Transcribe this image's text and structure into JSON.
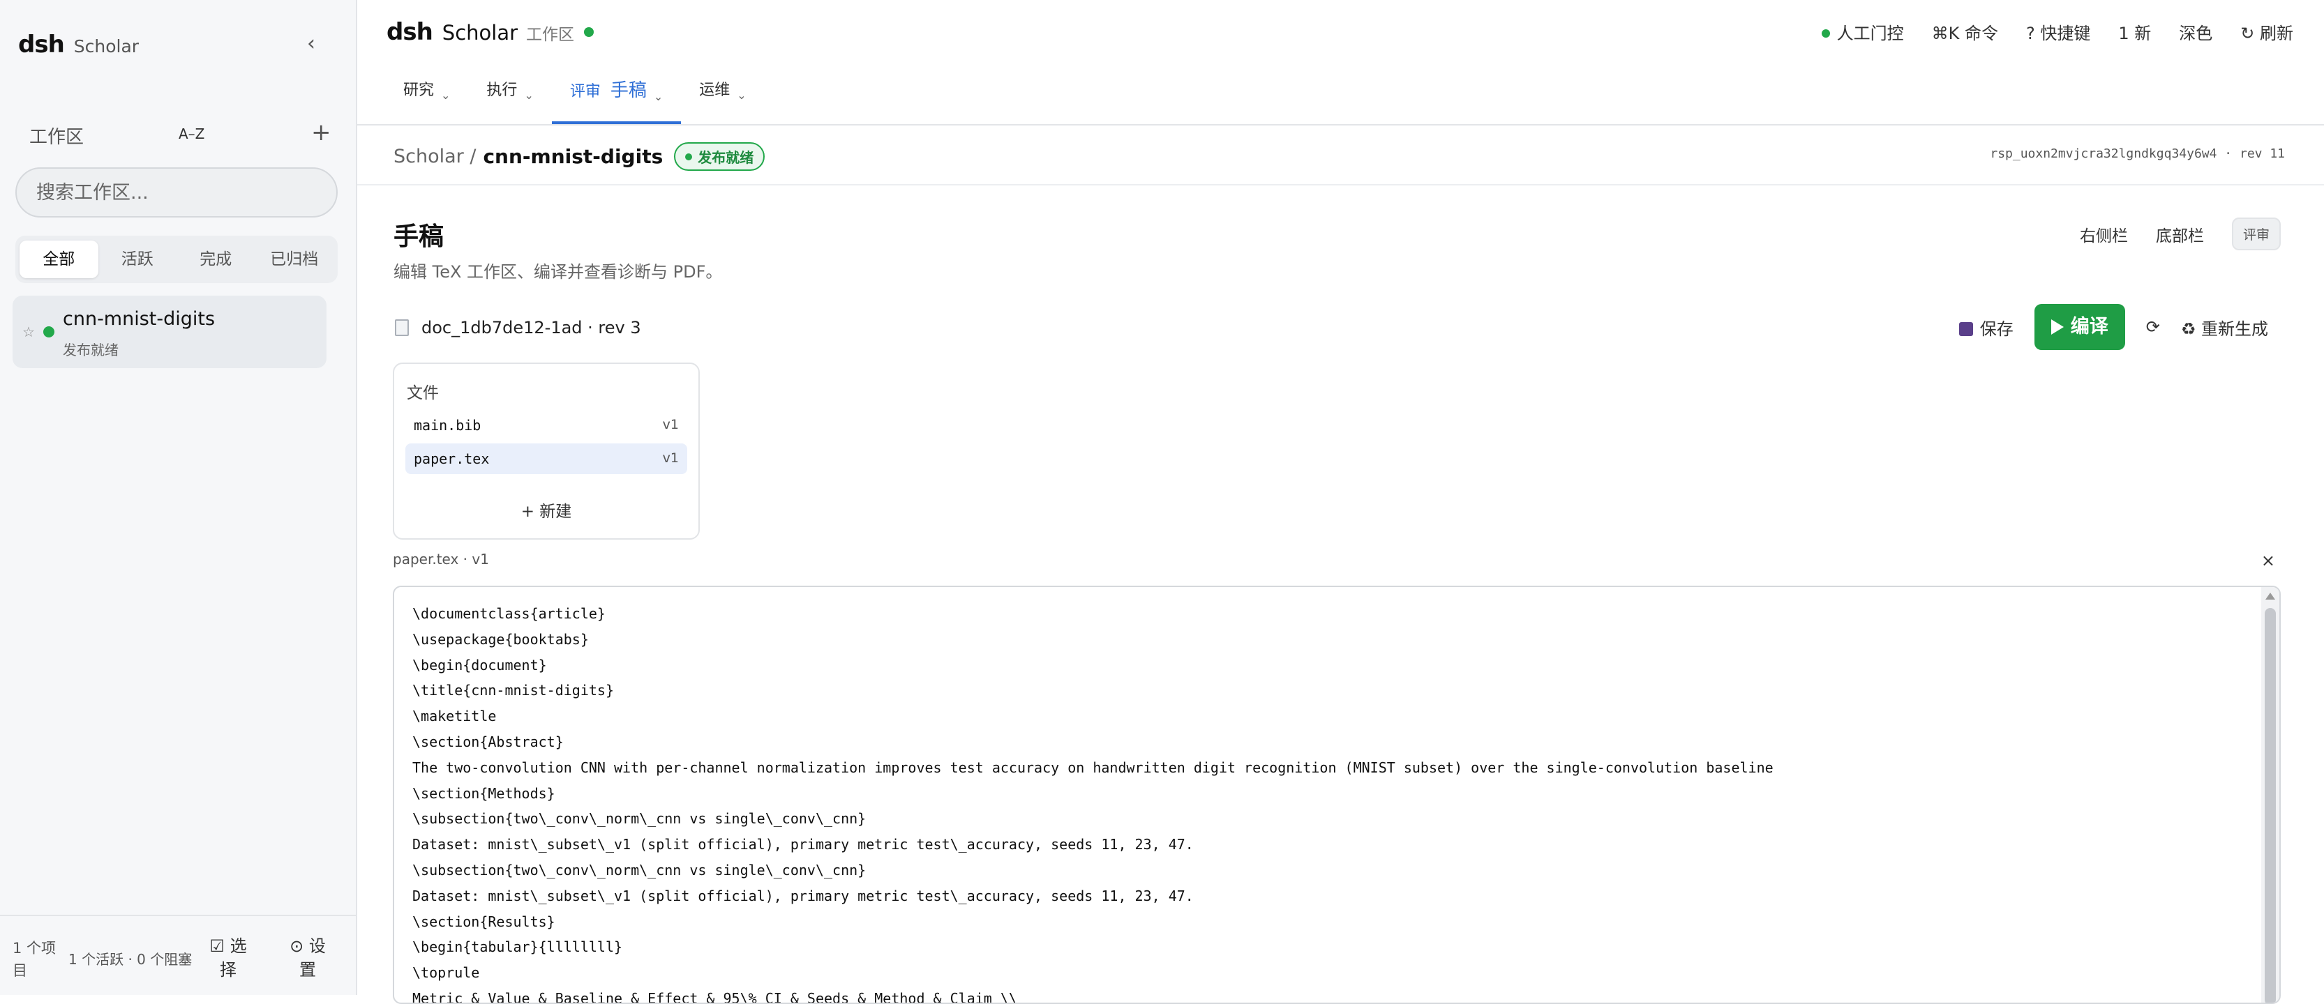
{
  "sidebar": {
    "brand_logo": "dsh",
    "brand_name": "Scholar",
    "collapse": "‹",
    "workspace_label": "工作区",
    "sort_label": "A–Z",
    "add_label": "+",
    "search_placeholder": "搜索工作区...",
    "filters": [
      "全部",
      "活跃",
      "完成",
      "已归档"
    ],
    "active_filter": "全部",
    "items": [
      {
        "star": "☆",
        "name": "cnn-mnist-digits",
        "status": "发布就绪"
      }
    ],
    "footer": {
      "count": "1 个项目",
      "summary": "1 个活跃 · 0 个阻塞",
      "select": "☑ 选择",
      "settings": "⊙ 设置"
    }
  },
  "topbar": {
    "logo": "dsh",
    "name": "Scholar",
    "workspace": "工作区",
    "actions": {
      "human_gate": "人工门控",
      "command": "⌘K 命令",
      "shortcuts": "? 快捷键",
      "new": "1 新",
      "theme": "深色",
      "refresh": "↻ 刷新"
    },
    "tabs": [
      {
        "label": "研究"
      },
      {
        "label": "执行"
      },
      {
        "label": "评审",
        "sub": "手稿"
      },
      {
        "label": "运维"
      }
    ],
    "chevron": "⌄"
  },
  "breadcrumb": {
    "root": "Scholar /",
    "current": "cnn-mnist-digits",
    "badge": "发布就绪",
    "run_id": "rsp_uoxn2mvjcra32lgndkgq34y6w4 · rev 11"
  },
  "page": {
    "title": "手稿",
    "description": "编辑 TeX 工作区、编译并查看诊断与 PDF。",
    "right_sidebar": "右侧栏",
    "bottom_bar": "底部栏",
    "review": "评审"
  },
  "doc": {
    "id": "doc_1db7de12-1ad · rev 3",
    "save": "保存",
    "compile": "编译",
    "refresh_icon": "⟳",
    "regenerate": "♻ 重新生成"
  },
  "files": {
    "title": "文件",
    "list": [
      {
        "name": "main.bib",
        "version": "v1"
      },
      {
        "name": "paper.tex",
        "version": "v1"
      }
    ],
    "new": "+ 新建"
  },
  "editor": {
    "label": "paper.tex · v1",
    "close": "×",
    "lines": [
      "\\documentclass{article}",
      "\\usepackage{booktabs}",
      "\\begin{document}",
      "\\title{cnn-mnist-digits}",
      "\\maketitle",
      "\\section{Abstract}",
      "The two-convolution CNN with per-channel normalization improves test accuracy on handwritten digit recognition (MNIST subset) over the single-convolution baseline",
      "\\section{Methods}",
      "\\subsection{two\\_conv\\_norm\\_cnn vs single\\_conv\\_cnn}",
      "Dataset: mnist\\_subset\\_v1 (split official), primary metric test\\_accuracy, seeds 11, 23, 47.",
      "\\subsection{two\\_conv\\_norm\\_cnn vs single\\_conv\\_cnn}",
      "Dataset: mnist\\_subset\\_v1 (split official), primary metric test\\_accuracy, seeds 11, 23, 47.",
      "\\section{Results}",
      "\\begin{tabular}{llllllll}",
      "\\toprule",
      "Metric & Value & Baseline & Effect & 95\\% CI & Seeds & Method & Claim \\\\"
    ]
  },
  "colors": {
    "accent": "#2f6fd6",
    "success": "#22a84a",
    "compile_bg": "#1f9d45"
  }
}
